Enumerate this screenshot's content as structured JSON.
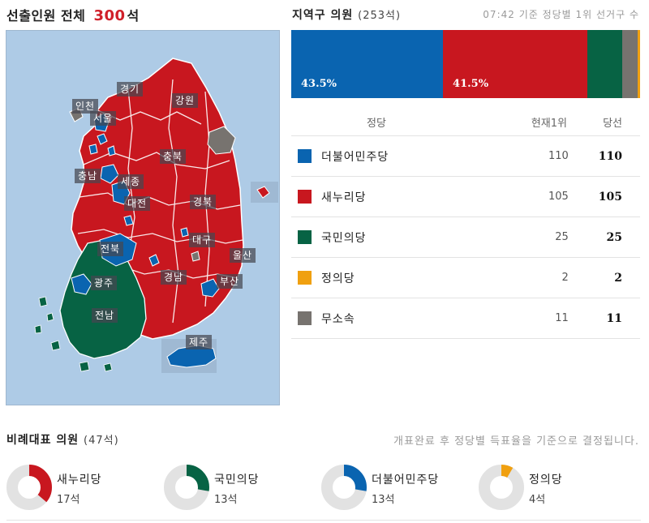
{
  "header": {
    "label": "선출인원 전체",
    "count": "300",
    "unit": "석"
  },
  "map": {
    "labels": {
      "incheon": "인천",
      "gyeonggi": "경기",
      "gangwon": "강원",
      "seoul": "서울",
      "chungbuk": "충북",
      "chungnam": "충남",
      "sejong": "세종",
      "daejeon": "대전",
      "gyeongbuk": "경북",
      "jeonbuk": "전북",
      "daegu": "대구",
      "ulsan": "울산",
      "gwangju": "광주",
      "gyeongnam": "경남",
      "busan": "부산",
      "jeonnam": "전남",
      "jeju": "제주"
    }
  },
  "district": {
    "title": "지역구 의원",
    "seats": "(253석)",
    "note": "07:42 기준 정당별 1위 선거구 수",
    "bar": [
      {
        "name": "더불어민주당",
        "share": 43.5,
        "label": "43.5%",
        "color": "#0a64b0"
      },
      {
        "name": "새누리당",
        "share": 41.5,
        "label": "41.5%",
        "color": "#c8171f"
      },
      {
        "name": "국민의당",
        "share": 9.9,
        "label": "",
        "color": "#076344"
      },
      {
        "name": "무소속",
        "share": 4.3,
        "label": "",
        "color": "#77736f"
      },
      {
        "name": "정의당",
        "share": 0.8,
        "label": "",
        "color": "#f0a010"
      }
    ],
    "table": {
      "headers": {
        "party": "정당",
        "current": "현재1위",
        "won": "당선"
      },
      "rows": [
        {
          "party": "더불어민주당",
          "current": "110",
          "won": "110",
          "color": "#0a64b0"
        },
        {
          "party": "새누리당",
          "current": "105",
          "won": "105",
          "color": "#c8171f"
        },
        {
          "party": "국민의당",
          "current": "25",
          "won": "25",
          "color": "#076344"
        },
        {
          "party": "정의당",
          "current": "2",
          "won": "2",
          "color": "#f0a010"
        },
        {
          "party": "무소속",
          "current": "11",
          "won": "11",
          "color": "#77736f"
        }
      ]
    }
  },
  "proportional": {
    "title": "비례대표 의원",
    "seats": "(47석)",
    "note": "개표완료 후 정당별 득표율을 기준으로 결정됩니다.",
    "items": [
      {
        "party": "새누리당",
        "seats": "17석",
        "share": 0.362,
        "color": "#c8171f"
      },
      {
        "party": "국민의당",
        "seats": "13석",
        "share": 0.277,
        "color": "#076344"
      },
      {
        "party": "더불어민주당",
        "seats": "13석",
        "share": 0.277,
        "color": "#0a64b0"
      },
      {
        "party": "정의당",
        "seats": "4석",
        "share": 0.085,
        "color": "#f0a010"
      }
    ]
  }
}
